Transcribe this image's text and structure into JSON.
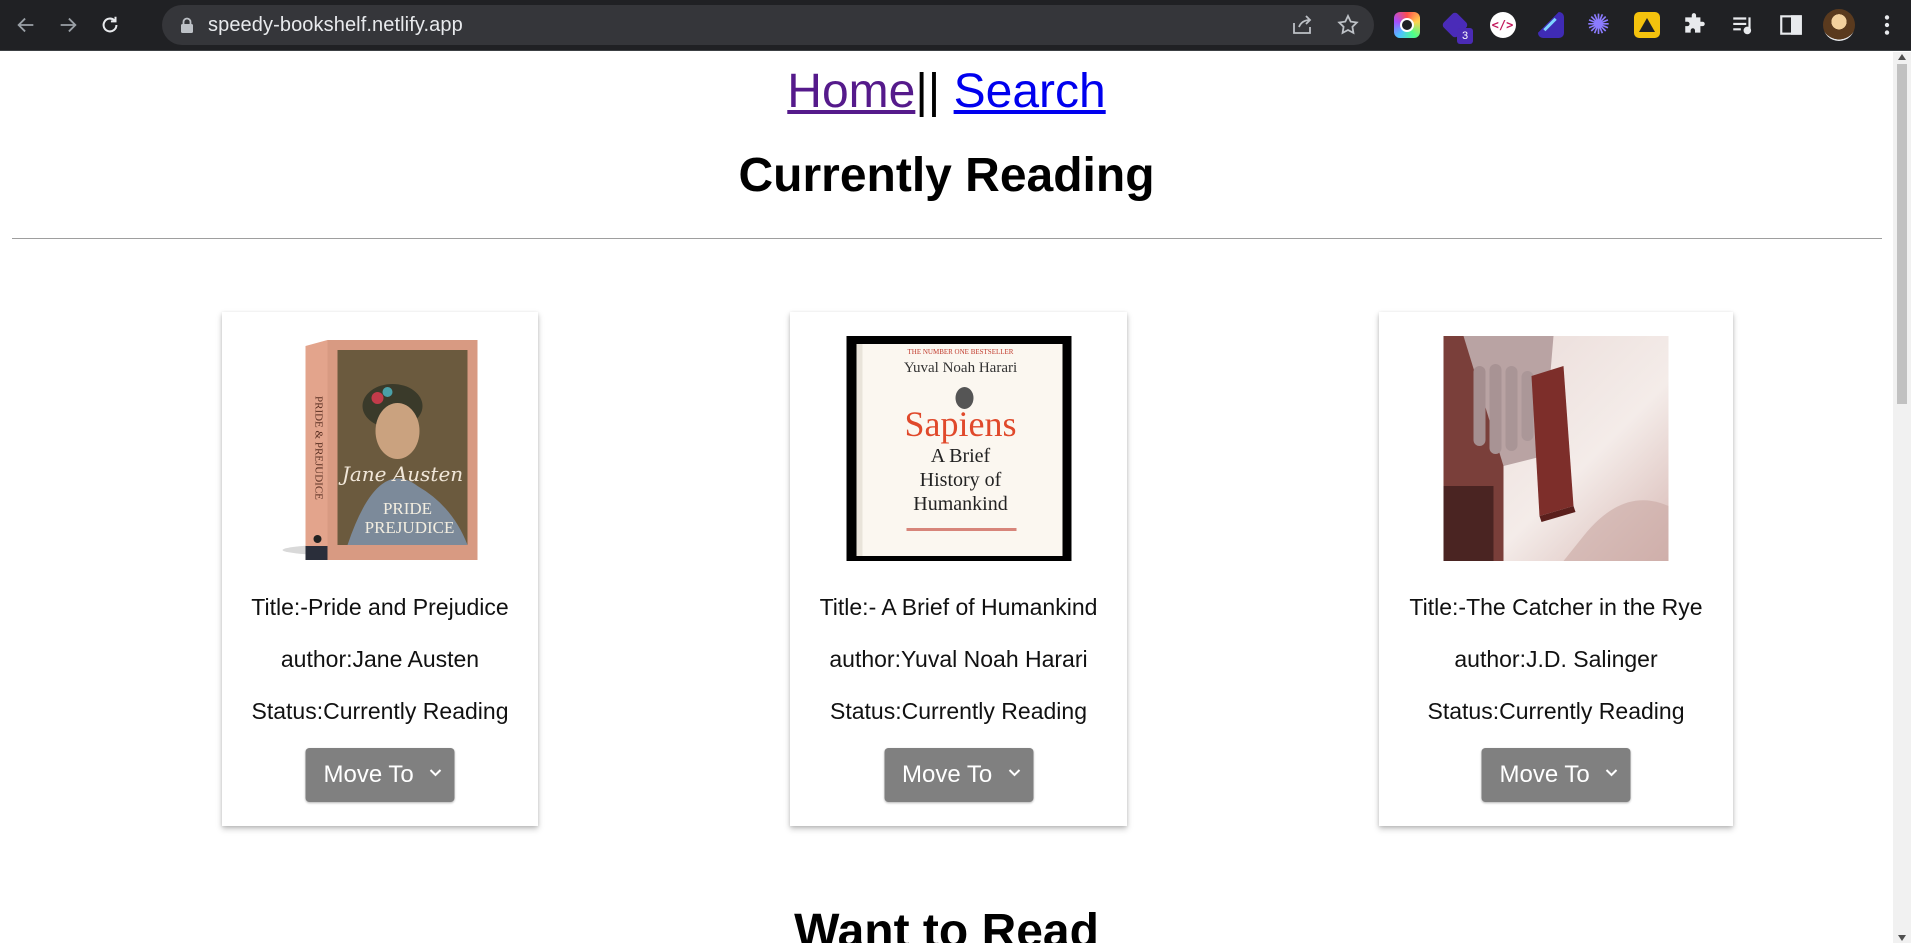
{
  "browser": {
    "url": "speedy-bookshelf.netlify.app",
    "extensions": [
      {
        "name": "color-picker-icon",
        "color": "#5ec6ff"
      },
      {
        "name": "stack-extension-icon",
        "color": "#6b3fd9",
        "badge": "3"
      },
      {
        "name": "code-extension-icon",
        "color": "#ffffff"
      },
      {
        "name": "magic-wand-extension-icon",
        "color": "#4b3ad9"
      },
      {
        "name": "snowflake-extension-icon",
        "color": "#7b6bff"
      },
      {
        "name": "warning-extension-icon",
        "color": "#f4c20d"
      }
    ]
  },
  "nav": {
    "home": "Home",
    "separator": "||",
    "search": "Search"
  },
  "sections": {
    "current": "Currently Reading",
    "want": "Want to Read"
  },
  "books": [
    {
      "cover_name": "pride-and-prejudice-cover",
      "title": "Title:-Pride and Prejudice",
      "author": "author:Jane Austen",
      "status": "Status:Currently Reading",
      "button": "Move To"
    },
    {
      "cover_name": "sapiens-cover",
      "cover_top": "THE NUMBER ONE BESTSELLER",
      "cover_author": "Yuval Noah Harari",
      "cover_title": "Sapiens",
      "cover_sub1": "A Brief",
      "cover_sub2": "History of",
      "cover_sub3": "Humankind",
      "title": "Title:- A Brief of Humankind",
      "author": "author:Yuval Noah Harari",
      "status": "Status:Currently Reading",
      "button": "Move To"
    },
    {
      "cover_name": "catcher-in-the-rye-cover",
      "title": "Title:-The Catcher in the Rye",
      "author": "author:J.D. Salinger",
      "status": "Status:Currently Reading",
      "button": "Move To"
    }
  ]
}
